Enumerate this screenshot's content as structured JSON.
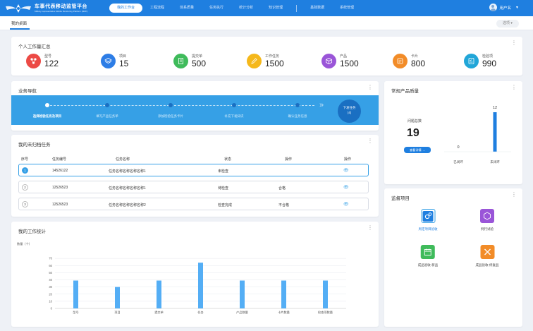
{
  "header": {
    "logo_title": "车事代表移动监管平台",
    "logo_subtitle": "Military representative Mobile Monitoring Platform (MRP)",
    "nav": [
      "我的工作台",
      "工程流程",
      "体系质量",
      "任务执行",
      "统计分析",
      "知识管理",
      "基础数据",
      "系统管理"
    ],
    "active_nav": 0,
    "user_name": "用户名"
  },
  "tabstrip": {
    "tab_label": "我的桌面",
    "ops_label": "选项 ▾"
  },
  "summary": {
    "title": "个人工作量汇总",
    "stats": [
      {
        "label": "型号",
        "value": "122",
        "color": "#ec4a45",
        "icon": "molecule-icon"
      },
      {
        "label": "项目",
        "value": "15",
        "color": "#2d7de6",
        "icon": "layers-icon"
      },
      {
        "label": "提交单",
        "value": "500",
        "color": "#3fbb5b",
        "icon": "document-icon"
      },
      {
        "label": "工作任务",
        "value": "1500",
        "color": "#f5b81b",
        "icon": "pencil-icon"
      },
      {
        "label": "产品",
        "value": "1500",
        "color": "#9a55d8",
        "icon": "cube-icon"
      },
      {
        "label": "卡片",
        "value": "800",
        "color": "#f28c28",
        "icon": "card-icon"
      },
      {
        "label": "检验项",
        "value": "990",
        "color": "#21a6d8",
        "icon": "checklist-icon"
      }
    ]
  },
  "guide": {
    "title": "业务导航",
    "steps": [
      "选择检验任务及项目",
      "填写产品任务单",
      "添加检验任务卡片",
      "补充下发知识",
      "确认任务信息"
    ],
    "next_label": "下发任务",
    "next_count": "(4)"
  },
  "unfinished": {
    "title": "我的未归档任务",
    "columns": [
      "序号",
      "任务编号",
      "任务名称",
      "状态",
      "操作",
      "操作"
    ],
    "rows": [
      {
        "num": "1",
        "code": "14526122",
        "name": "任务名称名称名称名称1",
        "status": "未检查",
        "remark": ""
      },
      {
        "num": "2",
        "code": "12526523",
        "name": "任务名称名称名称名称1",
        "status": "待检查",
        "remark": "合格"
      },
      {
        "num": "3",
        "code": "12526523",
        "name": "任务名称名称名称名称2",
        "status": "检查完成",
        "remark": "不合格"
      }
    ]
  },
  "work_stats": {
    "title": "我的工作统计",
    "unit_label": "数量（个）"
  },
  "chart_data": {
    "type": "bar",
    "categories": [
      "型号",
      "项目",
      "提交单",
      "任务",
      "产品数量",
      "卡片数量",
      "检查项数量"
    ],
    "values": [
      39,
      30,
      39,
      64,
      39,
      39,
      39
    ],
    "ylabel": "数量（个）",
    "ylim": [
      0,
      80
    ],
    "yticks": [
      0,
      10,
      20,
      30,
      40,
      50,
      60,
      70
    ],
    "grid": true,
    "color": "#54aef5"
  },
  "quality": {
    "title": "常规产品质量",
    "total_label": "问题总数",
    "total_value": "19",
    "view_label": "查看详情 →",
    "bars": [
      {
        "label": "已闭环",
        "value": 0
      },
      {
        "label": "未闭环",
        "value": 12
      }
    ]
  },
  "supervision": {
    "title": "监督项目",
    "items": [
      {
        "label": "周定项目验收",
        "icon": "gears-icon",
        "color": "#1f7fe0",
        "active": true
      },
      {
        "label": "例行试验",
        "icon": "hexagon-icon",
        "color": "#9a55d8",
        "active": false
      },
      {
        "label": "成品验收-新品",
        "icon": "calendar-icon",
        "color": "#3fbb5b",
        "active": false
      },
      {
        "label": "成品验收-修复品",
        "icon": "tools-icon",
        "color": "#f28c28",
        "active": false
      }
    ]
  }
}
